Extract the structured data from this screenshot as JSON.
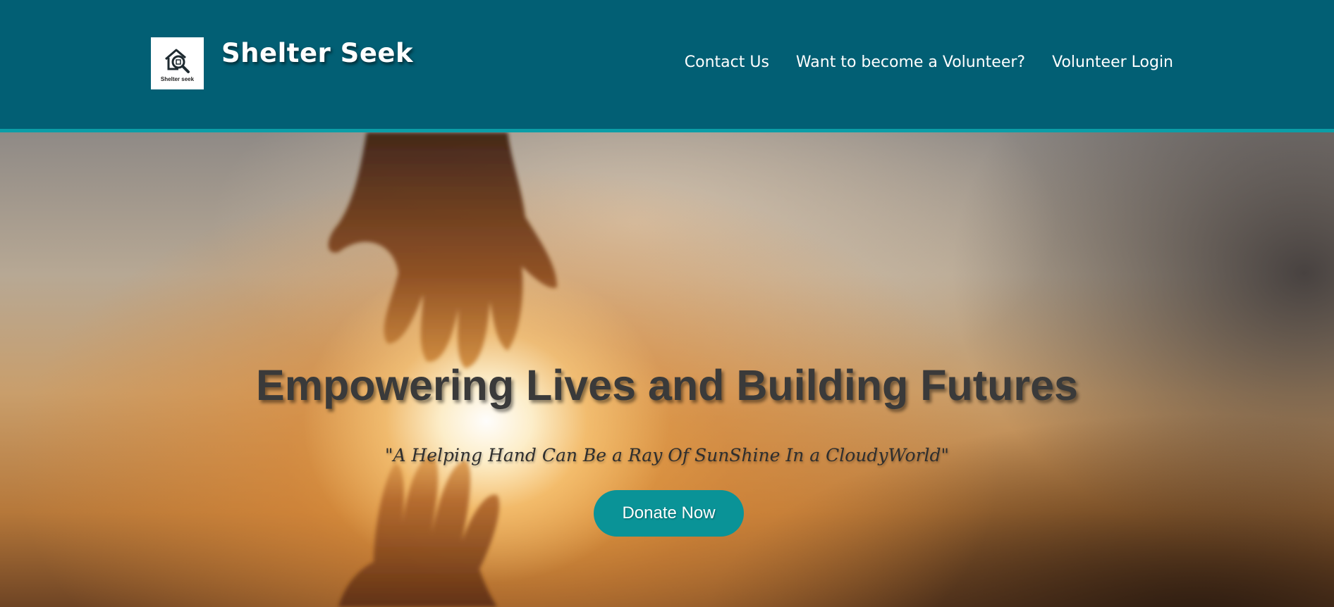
{
  "header": {
    "logo_caption": "Shelter seek",
    "brand": "Shelter Seek",
    "nav": [
      {
        "label": "Contact Us"
      },
      {
        "label": "Want to become a Volunteer?"
      },
      {
        "label": "Volunteer Login"
      }
    ],
    "colors": {
      "background": "#025f74",
      "rule": "#0b9ea7"
    }
  },
  "hero": {
    "headline": "Empowering Lives and Building Futures",
    "tagline": "\"A Helping Hand Can Be a Ray Of SunShine In a CloudyWorld\"",
    "donate_label": "Donate Now",
    "colors": {
      "button": "#0a9397"
    }
  },
  "icons": {
    "logo": "house-magnifier-icon"
  }
}
